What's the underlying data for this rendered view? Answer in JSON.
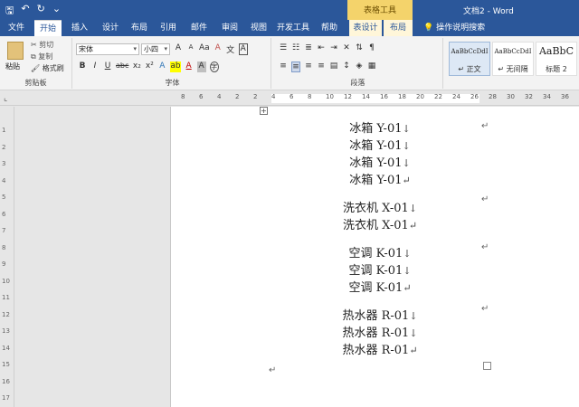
{
  "titlebar": {
    "qat": {
      "save_glyph": "🖫",
      "undo_glyph": "↶",
      "redo_glyph": "↻",
      "customize_glyph": "⌄"
    },
    "contextual_group": "表格工具",
    "document_title": "文档2 - Word"
  },
  "tabs": {
    "file": "文件",
    "items": [
      "开始",
      "插入",
      "设计",
      "布局",
      "引用",
      "邮件",
      "审阅",
      "视图",
      "开发工具",
      "帮助"
    ],
    "contextual": [
      "表设计",
      "布局"
    ],
    "tell_me": "操作说明搜索"
  },
  "ribbon": {
    "clipboard": {
      "label": "剪贴板",
      "paste": "粘贴",
      "cut": "剪切",
      "copy": "复制",
      "format_painter": "格式刷"
    },
    "font": {
      "label": "字体",
      "font_name": "宋体",
      "font_size": "小四",
      "grow": "A",
      "shrink": "A",
      "change_case": "Aa",
      "clear": "A",
      "wen": "文",
      "char_border": "A",
      "bold": "B",
      "italic": "I",
      "underline": "U",
      "strike": "abc",
      "subscript": "x₂",
      "superscript": "x²",
      "text_effect": "A",
      "highlight": "ab",
      "font_color": "A",
      "shading": "A",
      "enclose": "字"
    },
    "paragraph": {
      "label": "段落"
    },
    "styles": [
      {
        "sample": "AaBbCcDdI",
        "name": "↵ 正文",
        "selected": true
      },
      {
        "sample": "AaBbCcDdI",
        "name": "↵ 无间隔",
        "selected": false
      },
      {
        "sample": "AaBbC",
        "name": "标题 2",
        "selected": false
      }
    ]
  },
  "ruler": {
    "h_numbers": [
      "8",
      "6",
      "4",
      "2",
      "2",
      "4",
      "6",
      "8",
      "10",
      "12",
      "14",
      "16",
      "18",
      "20",
      "22",
      "24",
      "26",
      "28",
      "30",
      "32",
      "34",
      "36"
    ],
    "v_numbers": [
      "1",
      "2",
      "3",
      "4",
      "5",
      "6",
      "7",
      "8",
      "9",
      "10",
      "11",
      "12",
      "13",
      "14",
      "15",
      "16",
      "17"
    ]
  },
  "document": {
    "lines": [
      {
        "text": "冰箱 Y-01",
        "mark": "↓"
      },
      {
        "text": "冰箱 Y-01",
        "mark": "↓"
      },
      {
        "text": "冰箱 Y-01",
        "mark": "↓"
      },
      {
        "text": "冰箱 Y-01",
        "mark": "↵"
      },
      {
        "text": "洗衣机 X-01",
        "mark": "↓"
      },
      {
        "text": "洗衣机 X-01",
        "mark": "↵"
      },
      {
        "text": "空调 K-01",
        "mark": "↓"
      },
      {
        "text": "空调 K-01",
        "mark": "↓"
      },
      {
        "text": "空调 K-01",
        "mark": "↵"
      },
      {
        "text": "热水器 R-01",
        "mark": "↓"
      },
      {
        "text": "热水器 R-01",
        "mark": "↓"
      },
      {
        "text": "热水器 R-01",
        "mark": "↵"
      }
    ],
    "cell_end_mark": "↵",
    "paragraph_end_mark": "↵"
  }
}
